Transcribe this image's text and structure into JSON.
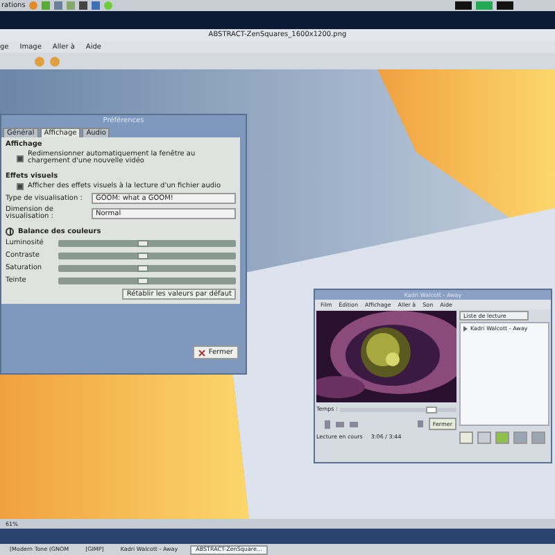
{
  "top_panel": {
    "menu_label": "rations"
  },
  "viewer": {
    "title": "ABSTRACT-ZenSquares_1600x1200.png",
    "menu": [
      "ge",
      "Image",
      "Aller à",
      "Aide"
    ],
    "zoom": "61%"
  },
  "preferences": {
    "title": "Préférences",
    "tabs": [
      {
        "label": "Général",
        "selected": false
      },
      {
        "label": "Affichage",
        "selected": true
      },
      {
        "label": "Audio",
        "selected": false
      }
    ],
    "display_heading": "Affichage",
    "resize_option": {
      "label": "Redimensionner automatiquement la fenêtre au chargement d'une nouvelle vidéo",
      "checked": true
    },
    "effects_heading": "Effets visuels",
    "effects_option": {
      "label": "Afficher des effets visuels à la lecture d'un fichier audio",
      "checked": true
    },
    "selects": [
      {
        "label": "Type de visualisation :",
        "value": "GOOM: what a GOOM!"
      },
      {
        "label": "Dimension de visualisation :",
        "value": "Normal"
      }
    ],
    "balance_heading": "Balance des couleurs",
    "balance_expanded": true,
    "sliders": [
      {
        "label": "Luminosité",
        "level": 0.48
      },
      {
        "label": "Contraste",
        "level": 0.48
      },
      {
        "label": "Saturation",
        "level": 0.48
      },
      {
        "label": "Teinte",
        "level": 0.48
      }
    ],
    "reset_button": "Rétablir les valeurs par défaut",
    "close_button": "Fermer"
  },
  "player": {
    "title": "Kadri Walcott - Away",
    "menu": [
      "Film",
      "Édition",
      "Affichage",
      "Aller à",
      "Son",
      "Aide"
    ],
    "sidebar_select": "Liste de lecture",
    "playlist": [
      {
        "label": "Kadri Walcott - Away",
        "selected": false
      }
    ],
    "time_label": "Temps :",
    "time_slider": {
      "level": 0.78
    },
    "close_button": "Fermer",
    "status": "Lecture en cours",
    "time": "3:06 / 3:44"
  },
  "taskbar": [
    {
      "label": "[Modern Tone (GNOM",
      "selected": false
    },
    {
      "label": "[GIMP]",
      "selected": false
    },
    {
      "label": "Kadri Walcott - Away",
      "selected": false
    },
    {
      "label": "ABSTRACT-ZenSquare...",
      "selected": true
    }
  ]
}
